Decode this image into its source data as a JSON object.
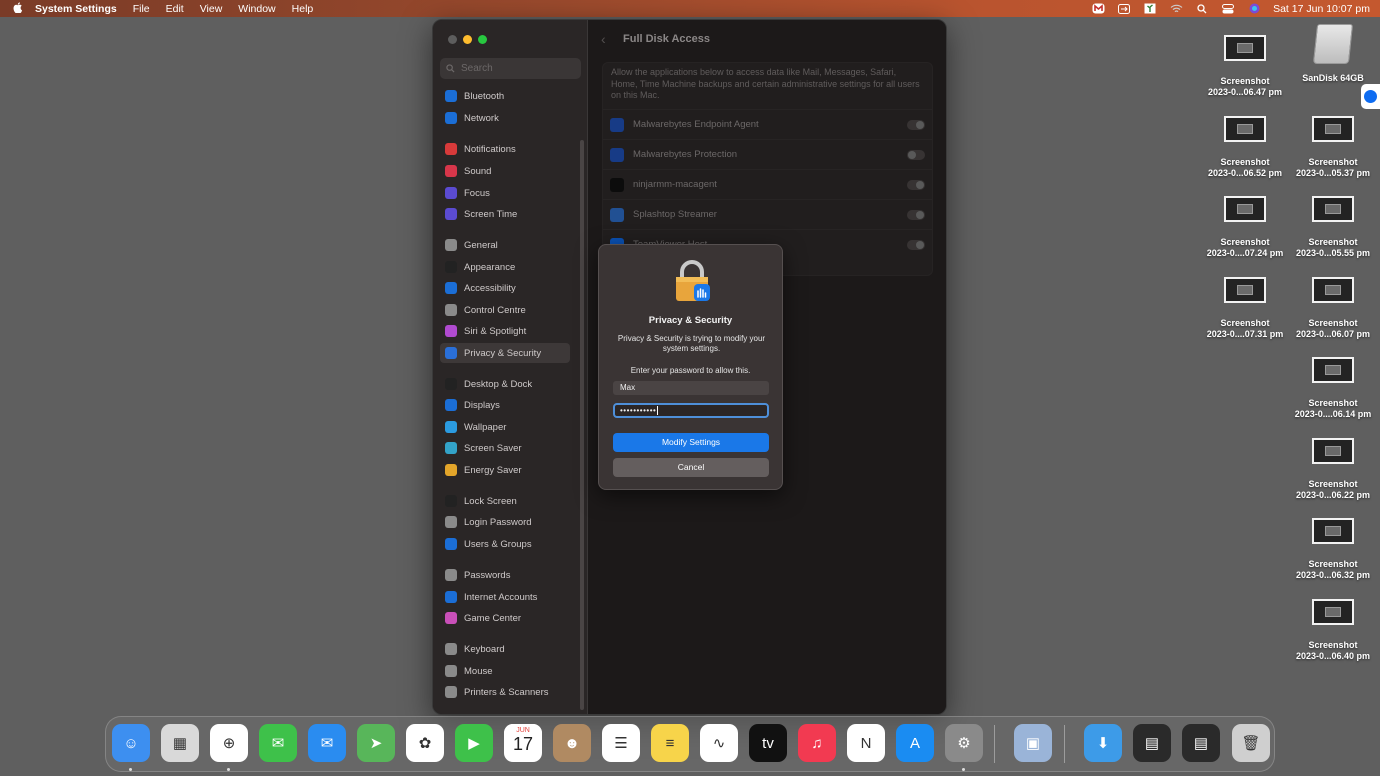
{
  "menubar": {
    "apple": "",
    "app_name": "System Settings",
    "menus": [
      "File",
      "Edit",
      "View",
      "Window",
      "Help"
    ],
    "clock": "Sat 17 Jun  10:07 pm"
  },
  "window": {
    "search_placeholder": "Search",
    "content_title": "Full Disk Access",
    "description": "Allow the applications below to access data like Mail, Messages, Safari, Home, Time Machine backups and certain administrative settings for all users on this Mac.",
    "apps": [
      {
        "name": "Malwarebytes Endpoint Agent",
        "enabled": true,
        "icon": "malwarebytes-icon",
        "color": "#1f4fb3"
      },
      {
        "name": "Malwarebytes Protection",
        "enabled": false,
        "icon": "malwarebytes-icon",
        "color": "#1f4fb3"
      },
      {
        "name": "ninjarmm-macagent",
        "enabled": true,
        "icon": "terminal-icon",
        "color": "#111111"
      },
      {
        "name": "Splashtop Streamer",
        "enabled": true,
        "icon": "splashtop-icon",
        "color": "#2c6bc4"
      },
      {
        "name": "TeamViewer Host",
        "enabled": true,
        "icon": "teamviewer-icon",
        "color": "#0e6cf1"
      }
    ]
  },
  "sidebar": {
    "items": [
      {
        "label": "Bluetooth",
        "color": "#1b6ed6",
        "name": "bluetooth"
      },
      {
        "label": "Network",
        "color": "#1b6ed6",
        "name": "network"
      },
      {
        "label": "Notifications",
        "color": "#d83a3a",
        "name": "notifications"
      },
      {
        "label": "Sound",
        "color": "#d8364a",
        "name": "sound"
      },
      {
        "label": "Focus",
        "color": "#5b4bd1",
        "name": "focus"
      },
      {
        "label": "Screen Time",
        "color": "#5b4bd1",
        "name": "screen-time"
      },
      {
        "label": "General",
        "color": "#8a8a8a",
        "name": "general"
      },
      {
        "label": "Appearance",
        "color": "#222222",
        "name": "appearance"
      },
      {
        "label": "Accessibility",
        "color": "#1b6ed6",
        "name": "accessibility"
      },
      {
        "label": "Control Centre",
        "color": "#8a8a8a",
        "name": "control-centre"
      },
      {
        "label": "Siri & Spotlight",
        "color": "#b04ad0",
        "name": "siri-spotlight"
      },
      {
        "label": "Privacy & Security",
        "color": "#2a6fd8",
        "name": "privacy-security"
      },
      {
        "label": "Desktop & Dock",
        "color": "#222222",
        "name": "desktop-dock"
      },
      {
        "label": "Displays",
        "color": "#1b6ed6",
        "name": "displays"
      },
      {
        "label": "Wallpaper",
        "color": "#2b9be0",
        "name": "wallpaper"
      },
      {
        "label": "Screen Saver",
        "color": "#33a3c8",
        "name": "screen-saver"
      },
      {
        "label": "Energy Saver",
        "color": "#e3a52a",
        "name": "energy-saver"
      },
      {
        "label": "Lock Screen",
        "color": "#222222",
        "name": "lock-screen"
      },
      {
        "label": "Login Password",
        "color": "#8a8a8a",
        "name": "login-password"
      },
      {
        "label": "Users & Groups",
        "color": "#1b6ed6",
        "name": "users-groups"
      },
      {
        "label": "Passwords",
        "color": "#8a8a8a",
        "name": "passwords"
      },
      {
        "label": "Internet Accounts",
        "color": "#1b6ed6",
        "name": "internet-accounts"
      },
      {
        "label": "Game Center",
        "color": "#c94fb8",
        "name": "game-center"
      },
      {
        "label": "Keyboard",
        "color": "#8a8a8a",
        "name": "keyboard"
      },
      {
        "label": "Mouse",
        "color": "#8a8a8a",
        "name": "mouse"
      },
      {
        "label": "Printers & Scanners",
        "color": "#8a8a8a",
        "name": "printers-scanners"
      }
    ]
  },
  "dialog": {
    "title": "Privacy & Security",
    "message": "Privacy & Security is trying to modify your system settings.",
    "prompt": "Enter your password to allow this.",
    "username": "Max",
    "password_masked": "•••••••••••",
    "modify_label": "Modify Settings",
    "cancel_label": "Cancel"
  },
  "desktop": {
    "screenshots": [
      {
        "label1": "Screenshot",
        "label2": "2023-0...06.47 pm"
      },
      {
        "label1": "Screenshot",
        "label2": "2023-0...06.52 pm"
      },
      {
        "label1": "Screenshot",
        "label2": "2023-0...05.37 pm"
      },
      {
        "label1": "Screenshot",
        "label2": "2023-0....07.24 pm"
      },
      {
        "label1": "Screenshot",
        "label2": "2023-0...05.55 pm"
      },
      {
        "label1": "Screenshot",
        "label2": "2023-0....07.31 pm"
      },
      {
        "label1": "Screenshot",
        "label2": "2023-0...06.07 pm"
      },
      {
        "label1": "Screenshot",
        "label2": "2023-0....06.14 pm"
      },
      {
        "label1": "Screenshot",
        "label2": "2023-0...06.22 pm"
      },
      {
        "label1": "Screenshot",
        "label2": "2023-0...06.32 pm"
      },
      {
        "label1": "Screenshot",
        "label2": "2023-0...06.40 pm"
      }
    ],
    "drive_label": "SanDisk 64GB"
  },
  "dock": {
    "apps": [
      {
        "name": "finder",
        "color": "#3d8ff0",
        "glyph": "☺",
        "running": true
      },
      {
        "name": "launchpad",
        "color": "#d9d9d9",
        "glyph": "▦",
        "running": false
      },
      {
        "name": "safari",
        "color": "#ffffff",
        "glyph": "⊕",
        "running": true
      },
      {
        "name": "messages",
        "color": "#3ec14a",
        "glyph": "✉",
        "running": false
      },
      {
        "name": "mail",
        "color": "#2a8cf0",
        "glyph": "✉",
        "running": false
      },
      {
        "name": "maps",
        "color": "#58b65a",
        "glyph": "➤",
        "running": false
      },
      {
        "name": "photos",
        "color": "#ffffff",
        "glyph": "✿",
        "running": false
      },
      {
        "name": "facetime",
        "color": "#3ec14a",
        "glyph": "▶",
        "running": false
      },
      {
        "name": "calendar",
        "color": "#ffffff",
        "glyph": "17",
        "running": false
      },
      {
        "name": "contacts",
        "color": "#b08a62",
        "glyph": "☻",
        "running": false
      },
      {
        "name": "reminders",
        "color": "#ffffff",
        "glyph": "☰",
        "running": false
      },
      {
        "name": "notes",
        "color": "#f7d44a",
        "glyph": "≡",
        "running": false
      },
      {
        "name": "freeform",
        "color": "#ffffff",
        "glyph": "∿",
        "running": false
      },
      {
        "name": "apple-tv",
        "color": "#111111",
        "glyph": "tv",
        "running": false
      },
      {
        "name": "music",
        "color": "#f23a51",
        "glyph": "♫",
        "running": false
      },
      {
        "name": "news",
        "color": "#ffffff",
        "glyph": "N",
        "running": false
      },
      {
        "name": "app-store",
        "color": "#1a8cf2",
        "glyph": "A",
        "running": false
      },
      {
        "name": "system-settings",
        "color": "#8a8a8a",
        "glyph": "⚙",
        "running": true
      },
      {
        "name": "preview",
        "color": "#9ab4d8",
        "glyph": "▣",
        "running": false
      },
      {
        "name": "downloads",
        "color": "#3d9be8",
        "glyph": "⬇",
        "running": false
      },
      {
        "name": "recent-window-1",
        "color": "#2a2a2a",
        "glyph": "▤",
        "running": false
      },
      {
        "name": "recent-window-2",
        "color": "#2a2a2a",
        "glyph": "▤",
        "running": false
      },
      {
        "name": "trash",
        "color": "#cfcfcf",
        "glyph": "🗑",
        "running": false
      }
    ],
    "calendar_month": "JUN",
    "calendar_day": "17"
  }
}
